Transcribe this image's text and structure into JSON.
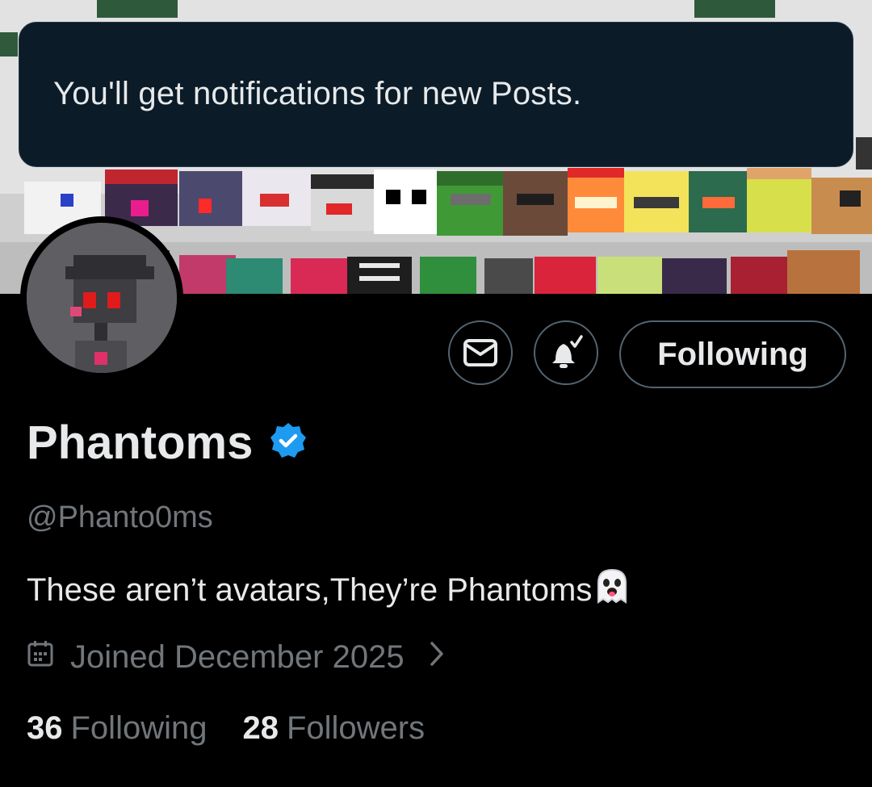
{
  "toast": {
    "message": "You'll get notifications for new Posts."
  },
  "profile": {
    "name": "Phantoms",
    "handle": "@Phanto0ms",
    "bio": "These aren’t avatars,They’re Phantoms",
    "bio_emoji": "ghost",
    "joined": "Joined December 2025",
    "verified": true
  },
  "actions": {
    "follow_label": "Following",
    "message_icon": "envelope-icon",
    "notify_icon": "bell-check-icon"
  },
  "stats": {
    "following_count": "36",
    "following_label": "Following",
    "followers_count": "28",
    "followers_label": "Followers"
  },
  "colors": {
    "background": "#000000",
    "toast_bg": "#0b1b28",
    "verified_blue": "#1d9bf0",
    "muted_text": "#71767b",
    "primary_text": "#e7e9ea",
    "border": "#536471"
  }
}
